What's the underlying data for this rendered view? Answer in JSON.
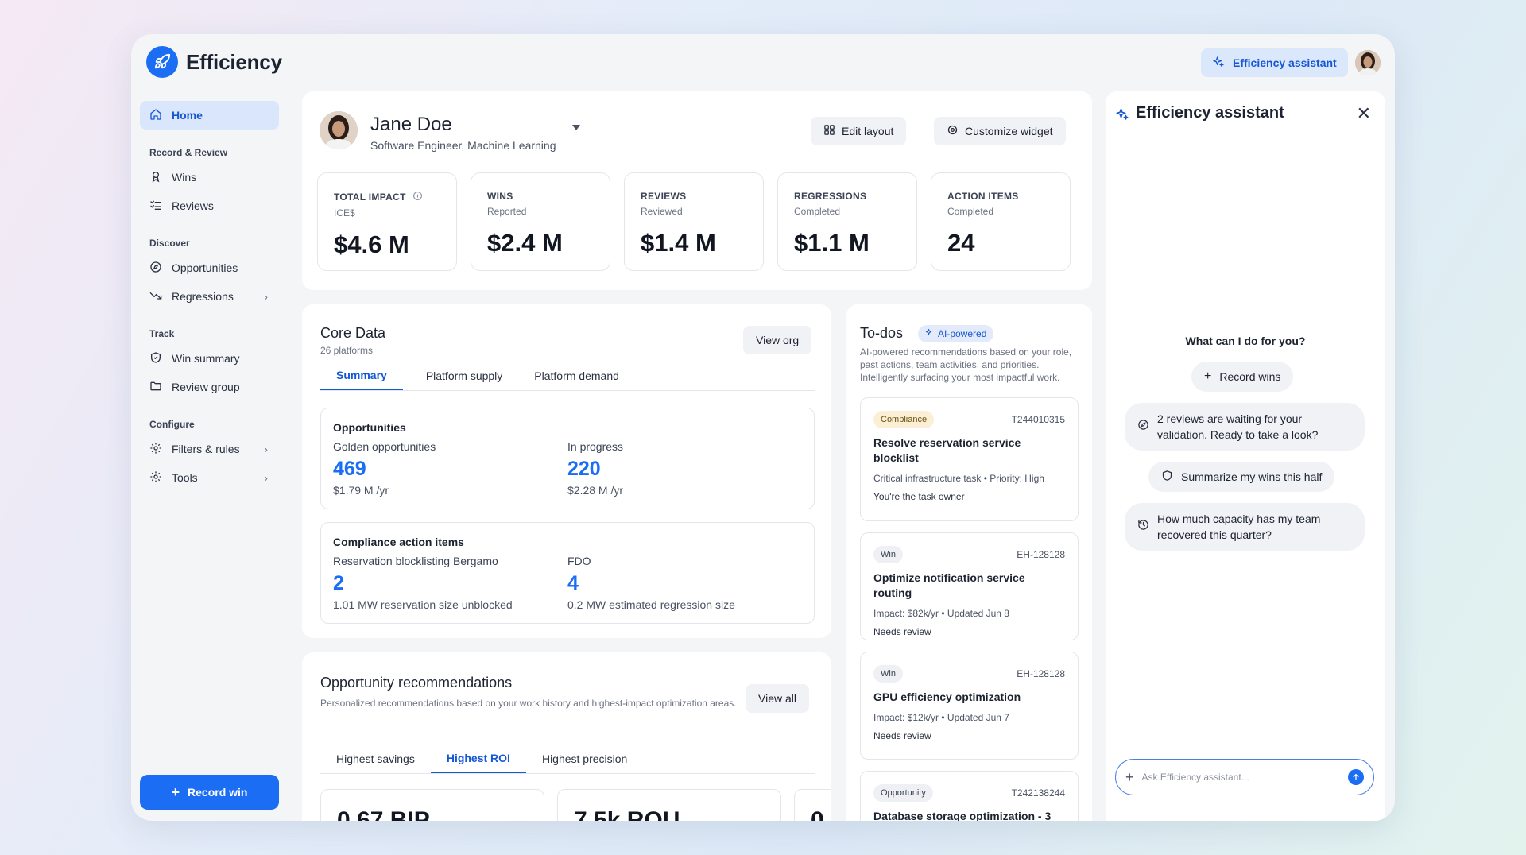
{
  "brand": {
    "name": "Efficiency"
  },
  "header": {
    "assistant_button": "Efficiency assistant"
  },
  "sidebar": {
    "home": "Home",
    "sections": [
      {
        "title": "Record & Review",
        "items": [
          {
            "label": "Wins",
            "icon": "award-icon"
          },
          {
            "label": "Reviews",
            "icon": "checklist-icon"
          }
        ]
      },
      {
        "title": "Discover",
        "items": [
          {
            "label": "Opportunities",
            "icon": "compass-icon"
          },
          {
            "label": "Regressions",
            "icon": "trend-down-icon",
            "chevron": true
          }
        ]
      },
      {
        "title": "Track",
        "items": [
          {
            "label": "Win summary",
            "icon": "shield-icon"
          },
          {
            "label": "Review group",
            "icon": "folder-icon"
          }
        ]
      },
      {
        "title": "Configure",
        "items": [
          {
            "label": "Filters & rules",
            "icon": "gear-icon",
            "chevron": true
          },
          {
            "label": "Tools",
            "icon": "gear-icon",
            "chevron": true
          }
        ]
      }
    ],
    "record_win": "Record win"
  },
  "profile": {
    "name": "Jane Doe",
    "role": "Software Engineer, Machine Learning",
    "edit_layout": "Edit layout",
    "customize_widget": "Customize widget",
    "metrics": [
      {
        "label": "TOTAL IMPACT",
        "sub": "ICE$",
        "value": "$4.6 M",
        "info": true
      },
      {
        "label": "WINS",
        "sub": "Reported",
        "value": "$2.4 M"
      },
      {
        "label": "REVIEWS",
        "sub": "Reviewed",
        "value": "$1.4 M"
      },
      {
        "label": "REGRESSIONS",
        "sub": "Completed",
        "value": "$1.1 M"
      },
      {
        "label": "ACTION ITEMS",
        "sub": "Completed",
        "value": "24"
      }
    ]
  },
  "core": {
    "title": "Core Data",
    "subtitle": "26 platforms",
    "view_org": "View org",
    "tabs": [
      "Summary",
      "Platform supply",
      "Platform demand"
    ],
    "opportunities": {
      "title": "Opportunities",
      "left": {
        "label": "Golden opportunities",
        "value": "469",
        "sub": "$1.79 M /yr"
      },
      "right": {
        "label": "In progress",
        "value": "220",
        "sub": "$2.28 M /yr"
      }
    },
    "compliance": {
      "title": "Compliance action items",
      "left": {
        "label": "Reservation blocklisting Bergamo",
        "value": "2",
        "sub": "1.01 MW reservation size unblocked"
      },
      "right": {
        "label": "FDO",
        "value": "4",
        "sub": "0.2 MW estimated regression size"
      }
    }
  },
  "recommendations": {
    "title": "Opportunity recommendations",
    "subtitle": "Personalized recommendations based on your work history and highest-impact optimization areas.",
    "view_all": "View all",
    "tabs": [
      "Highest savings",
      "Highest ROI",
      "Highest precision"
    ],
    "cards": [
      "0.67 BIP",
      "7.5k ROU",
      "0"
    ]
  },
  "todos": {
    "title": "To-dos",
    "pill": "AI-powered",
    "subtitle": "AI-powered recommendations based on your role, past actions, team activities, and priorities. Intelligently surfacing your most impactful work.",
    "items": [
      {
        "badge": "Compliance",
        "id": "T244010315",
        "title": "Resolve reservation service blocklist",
        "meta": "Critical infrastructure task • Priority: High",
        "owner": "You're the task owner"
      },
      {
        "badge": "Win",
        "id": "EH-128128",
        "title": "Optimize notification service routing",
        "meta": "Impact: $82k/yr • Updated Jun 8",
        "owner": "Needs review"
      },
      {
        "badge": "Win",
        "id": "EH-128128",
        "title": "GPU efficiency optimization",
        "meta": "Impact: $12k/yr • Updated Jun 7",
        "owner": "Needs review"
      },
      {
        "badge": "Opportunity",
        "id": "T242138244",
        "title": "Database storage optimization - 3"
      }
    ]
  },
  "assistant": {
    "title": "Efficiency assistant",
    "question": "What can I do for you?",
    "chips": [
      {
        "text": "Record wins",
        "icon": "plus-icon"
      },
      {
        "text": "2 reviews are waiting for your validation. Ready to take a look?",
        "icon": "compass-icon"
      },
      {
        "text": "Summarize my wins this half",
        "icon": "shield-icon"
      },
      {
        "text": "How much capacity has my team recovered this quarter?",
        "icon": "history-icon"
      }
    ],
    "input_placeholder": "Ask Efficiency assistant..."
  }
}
